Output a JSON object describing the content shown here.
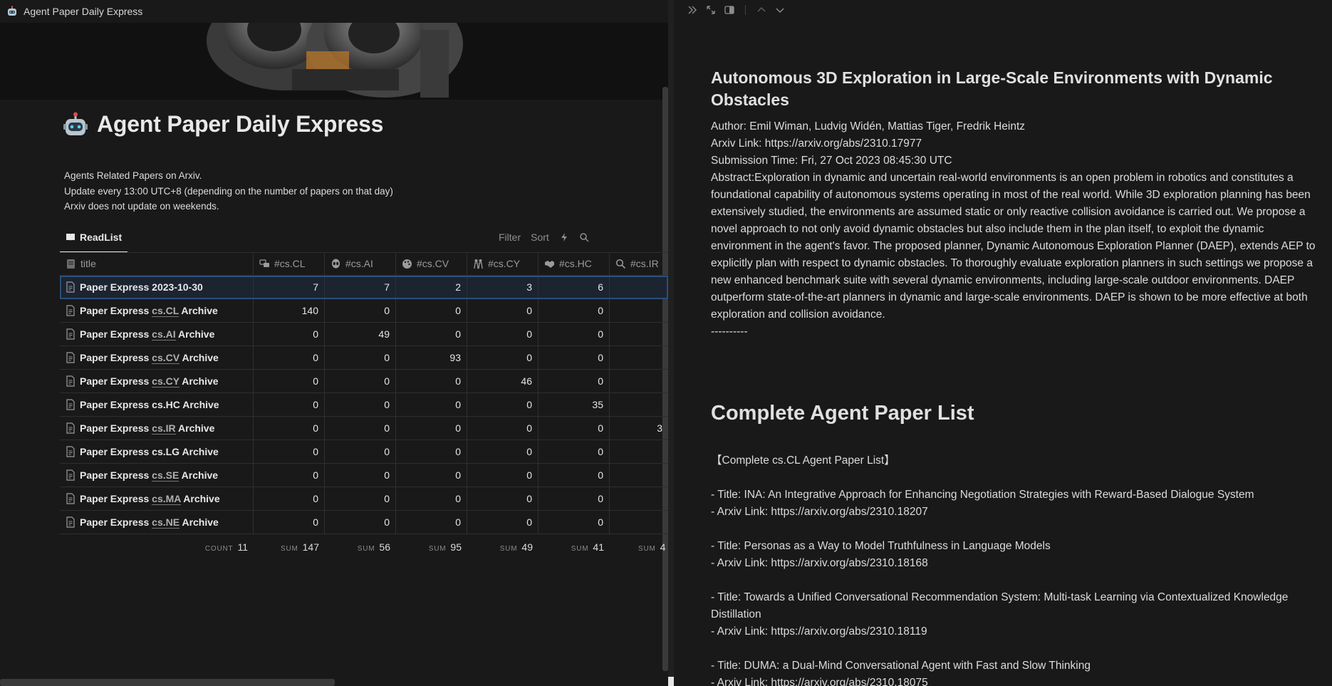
{
  "window": {
    "title": "Agent Paper Daily Express"
  },
  "page": {
    "title": "Agent Paper Daily Express",
    "description": [
      "Agents Related Papers on Arxiv.",
      "Update every 13:00 UTC+8 (depending on the number of papers on that day)",
      "Arxiv does not update on weekends."
    ]
  },
  "database": {
    "view_tab": "ReadList",
    "tools": {
      "filter": "Filter",
      "sort": "Sort"
    },
    "columns": [
      "title",
      "#cs.CL",
      "#cs.AI",
      "#cs.CV",
      "#cs.CY",
      "#cs.HC",
      "#cs.IR"
    ],
    "rows": [
      {
        "pre": "Paper Express 2023-10-30",
        "tag": "",
        "post": "",
        "values": [
          "7",
          "7",
          "2",
          "3",
          "6",
          ""
        ]
      },
      {
        "pre": "Paper Express ",
        "tag": "cs.CL",
        "post": " Archive",
        "values": [
          "140",
          "0",
          "0",
          "0",
          "0",
          ""
        ]
      },
      {
        "pre": "Paper Express ",
        "tag": "cs.AI",
        "post": " Archive",
        "values": [
          "0",
          "49",
          "0",
          "0",
          "0",
          ""
        ]
      },
      {
        "pre": "Paper Express ",
        "tag": "cs.CV",
        "post": " Archive",
        "values": [
          "0",
          "0",
          "93",
          "0",
          "0",
          ""
        ]
      },
      {
        "pre": "Paper Express ",
        "tag": "cs.CY",
        "post": " Archive",
        "values": [
          "0",
          "0",
          "0",
          "46",
          "0",
          ""
        ]
      },
      {
        "pre": "Paper Express cs.HC Archive",
        "tag": "",
        "post": "",
        "values": [
          "0",
          "0",
          "0",
          "0",
          "35",
          ""
        ]
      },
      {
        "pre": "Paper Express ",
        "tag": "cs.IR",
        "post": " Archive",
        "values": [
          "0",
          "0",
          "0",
          "0",
          "0",
          "3"
        ]
      },
      {
        "pre": "Paper Express cs.LG Archive",
        "tag": "",
        "post": "",
        "values": [
          "0",
          "0",
          "0",
          "0",
          "0",
          ""
        ]
      },
      {
        "pre": "Paper Express ",
        "tag": "cs.SE",
        "post": " Archive",
        "values": [
          "0",
          "0",
          "0",
          "0",
          "0",
          ""
        ]
      },
      {
        "pre": "Paper Express ",
        "tag": "cs.MA",
        "post": " Archive",
        "values": [
          "0",
          "0",
          "0",
          "0",
          "0",
          ""
        ]
      },
      {
        "pre": "Paper Express ",
        "tag": "cs.NE",
        "post": " Archive",
        "values": [
          "0",
          "0",
          "0",
          "0",
          "0",
          ""
        ]
      }
    ],
    "footer": {
      "count_label": "COUNT",
      "count": "11",
      "sum_label": "SUM",
      "sums": [
        "147",
        "56",
        "95",
        "49",
        "41",
        "4"
      ]
    }
  },
  "detail": {
    "paper_title": "Autonomous 3D Exploration in Large-Scale Environments with Dynamic Obstacles",
    "author": "Author: Emil Wiman,  Ludvig Widén,  Mattias Tiger,  Fredrik Heintz",
    "arxiv_link": "Arxiv Link: https://arxiv.org/abs/2310.17977",
    "submission_time": "Submission Time: Fri, 27 Oct 2023 08:45:30 UTC",
    "abstract": "Abstract:Exploration in dynamic and uncertain real-world environments is an open problem in robotics and constitutes a foundational capability of autonomous systems operating in most of the real world. While 3D exploration planning has been extensively studied, the environments are assumed static or only reactive collision avoidance is carried out. We propose a novel approach to not only avoid dynamic obstacles but also include them in the plan itself, to exploit the dynamic environment in the agent's favor. The proposed planner, Dynamic Autonomous Exploration Planner (DAEP), extends AEP to explicitly plan with respect to dynamic obstacles. To thoroughly evaluate exploration planners in such settings we propose a new enhanced benchmark suite with several dynamic environments, including large-scale outdoor environments. DAEP outperform state-of-the-art planners in dynamic and large-scale environments. DAEP is shown to be more effective at both exploration and collision avoidance.",
    "separator": "----------",
    "section_title": "Complete Agent Paper List",
    "list_heading": "【Complete cs.CL Agent Paper List】",
    "papers": [
      {
        "title": "- Title:  INA: An Integrative Approach for Enhancing Negotiation Strategies with  Reward-Based Dialogue System",
        "link": "- Arxiv Link: https://arxiv.org/abs/2310.18207"
      },
      {
        "title": "- Title:  Personas as a Way to Model Truthfulness in Language Models",
        "link": "- Arxiv Link: https://arxiv.org/abs/2310.18168"
      },
      {
        "title": "- Title:  Towards a Unified Conversational Recommendation System: Multi-task  Learning via Contextualized Knowledge Distillation",
        "link": "- Arxiv Link: https://arxiv.org/abs/2310.18119"
      },
      {
        "title": "- Title:  DUMA: a Dual-Mind Conversational Agent with Fast and Slow Thinking",
        "link": "- Arxiv Link: https://arxiv.org/abs/2310.18075"
      }
    ]
  }
}
